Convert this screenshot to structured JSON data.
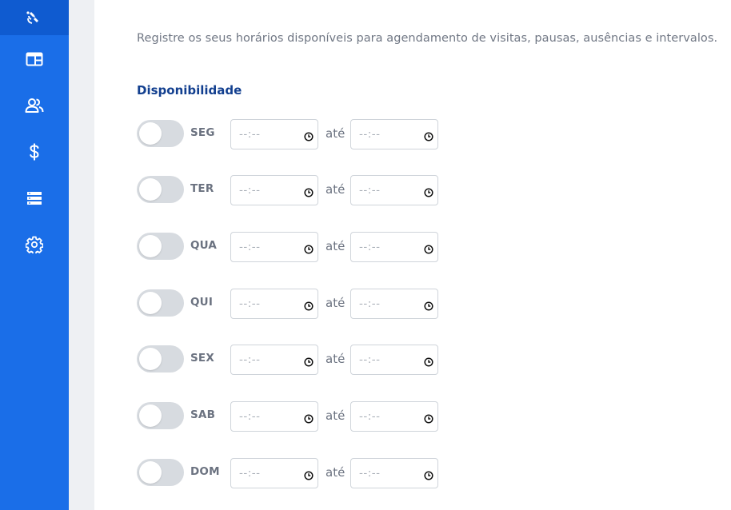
{
  "sidebar": {
    "items": [
      {
        "icon": "satellite-icon",
        "active": true
      },
      {
        "icon": "layout-icon",
        "active": false
      },
      {
        "icon": "users-icon",
        "active": false
      },
      {
        "icon": "dollar-icon",
        "active": false
      },
      {
        "icon": "server-icon",
        "active": false
      },
      {
        "icon": "gear-icon",
        "active": false
      }
    ]
  },
  "intro_text": "Registre os seus horários disponíveis para agendamento de visitas, pausas, ausências e intervalos.",
  "section_title": "Disponibilidade",
  "separator": "até",
  "time_placeholder": "--:--",
  "days": [
    {
      "label": "SEG",
      "enabled": false,
      "from": "--:--",
      "to": "--:--"
    },
    {
      "label": "TER",
      "enabled": false,
      "from": "--:--",
      "to": "--:--"
    },
    {
      "label": "QUA",
      "enabled": false,
      "from": "--:--",
      "to": "--:--"
    },
    {
      "label": "QUI",
      "enabled": false,
      "from": "--:--",
      "to": "--:--"
    },
    {
      "label": "SEX",
      "enabled": false,
      "from": "--:--",
      "to": "--:--"
    },
    {
      "label": "SAB",
      "enabled": false,
      "from": "--:--",
      "to": "--:--"
    },
    {
      "label": "DOM",
      "enabled": false,
      "from": "--:--",
      "to": "--:--"
    }
  ],
  "colors": {
    "sidebar": "#1a6ee8",
    "sidebar_active": "#0f5bd0",
    "title": "#123f8f",
    "toggle_off": "#d7dbe0"
  }
}
